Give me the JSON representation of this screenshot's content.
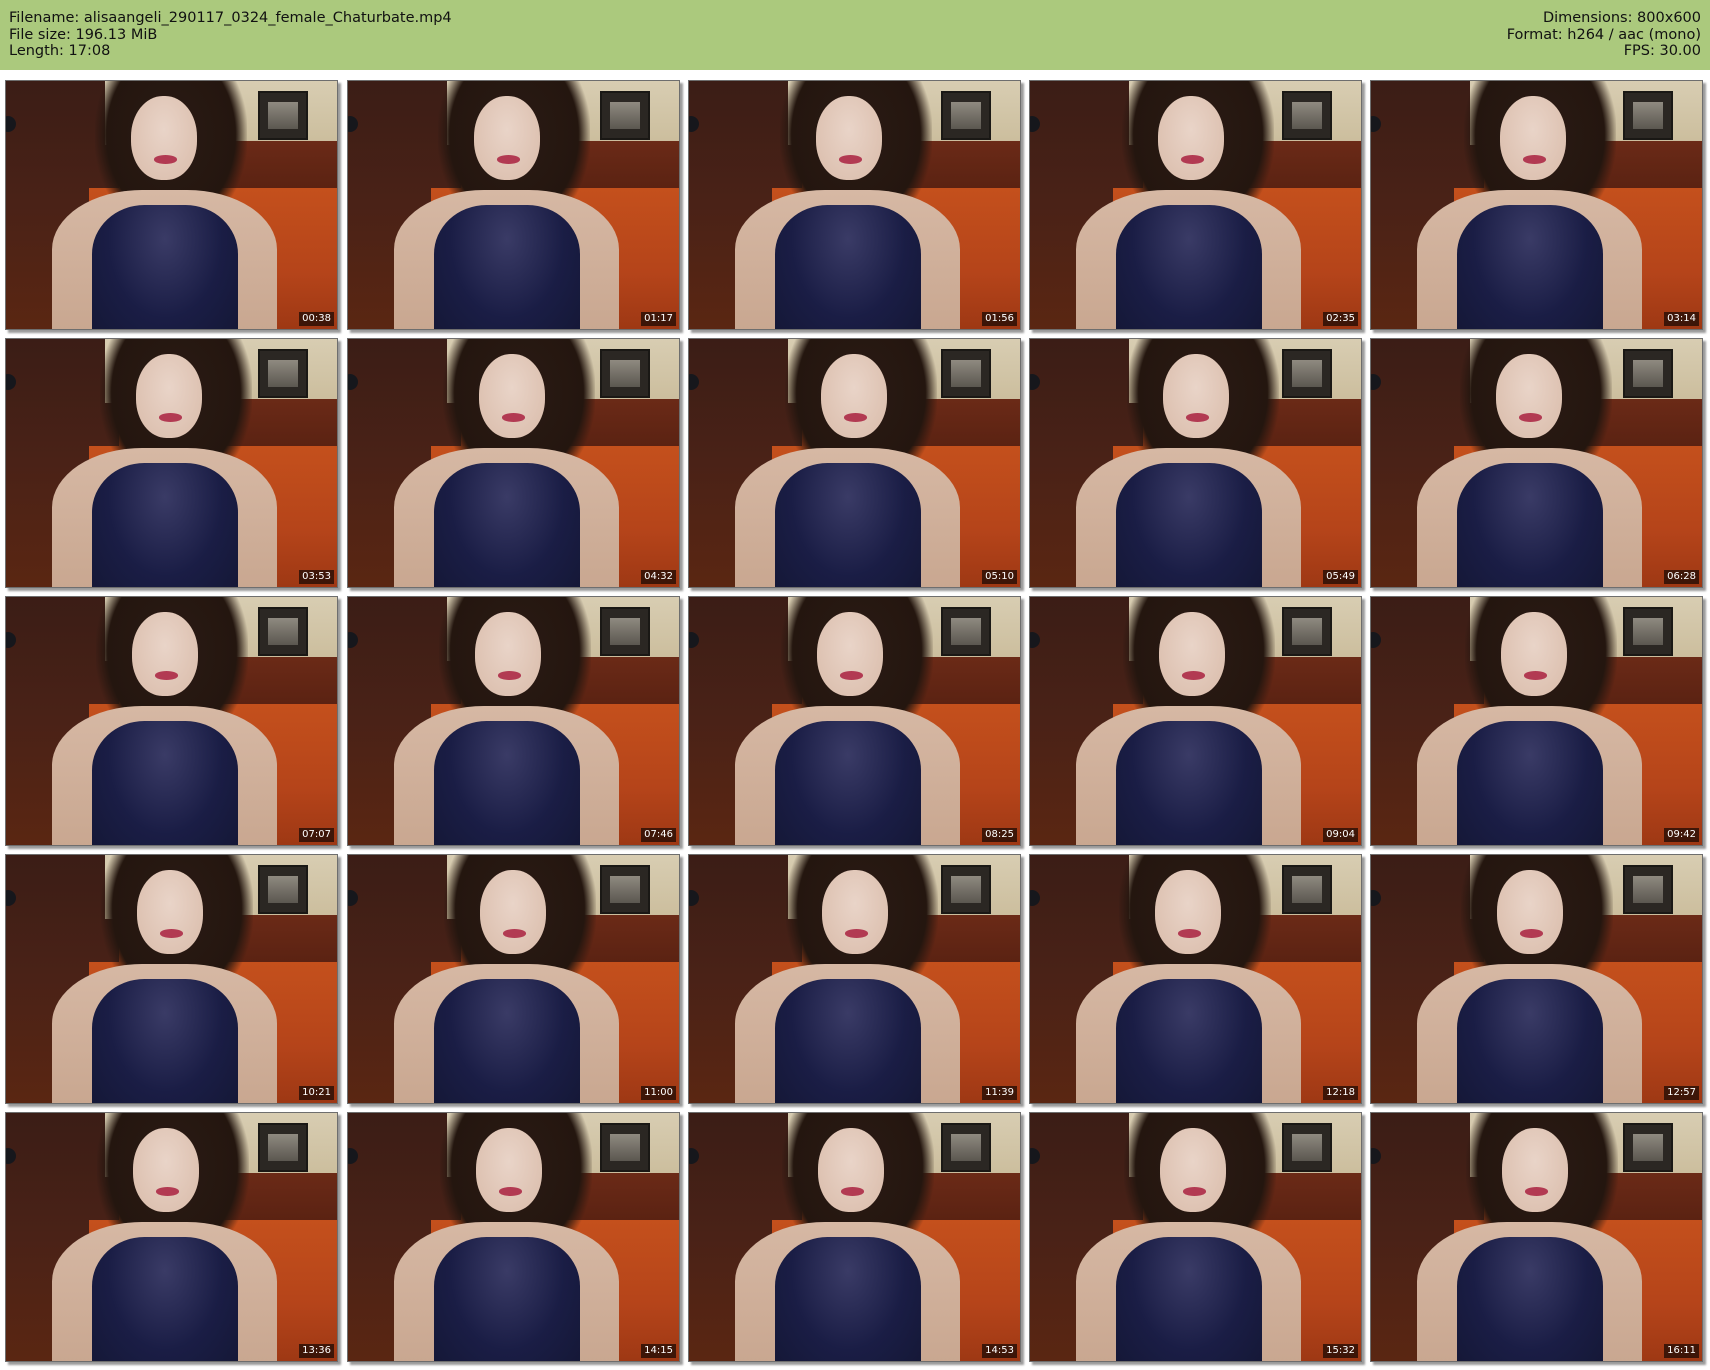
{
  "header": {
    "filename": "Filename: alisaangeli_290117_0324_female_Chaturbate.mp4",
    "file_size": "File size: 196.13 MiB",
    "length": "Length: 17:08",
    "dimensions": "Dimensions: 800x600",
    "format": "Format: h264 / aac (mono)",
    "fps": "FPS: 30.00"
  },
  "colors": {
    "header_background": "#abc97d",
    "page_background": "#ffffff",
    "timestamp_background": "#000000",
    "timestamp_text": "#ffffff"
  },
  "thumbnails": [
    {
      "timestamp": "00:38"
    },
    {
      "timestamp": "01:17"
    },
    {
      "timestamp": "01:56"
    },
    {
      "timestamp": "02:35"
    },
    {
      "timestamp": "03:14"
    },
    {
      "timestamp": "03:53"
    },
    {
      "timestamp": "04:32"
    },
    {
      "timestamp": "05:10"
    },
    {
      "timestamp": "05:49"
    },
    {
      "timestamp": "06:28"
    },
    {
      "timestamp": "07:07"
    },
    {
      "timestamp": "07:46"
    },
    {
      "timestamp": "08:25"
    },
    {
      "timestamp": "09:04"
    },
    {
      "timestamp": "09:42"
    },
    {
      "timestamp": "10:21"
    },
    {
      "timestamp": "11:00"
    },
    {
      "timestamp": "11:39"
    },
    {
      "timestamp": "12:18"
    },
    {
      "timestamp": "12:57"
    },
    {
      "timestamp": "13:36"
    },
    {
      "timestamp": "14:15"
    },
    {
      "timestamp": "14:53"
    },
    {
      "timestamp": "15:32"
    },
    {
      "timestamp": "16:11"
    }
  ]
}
